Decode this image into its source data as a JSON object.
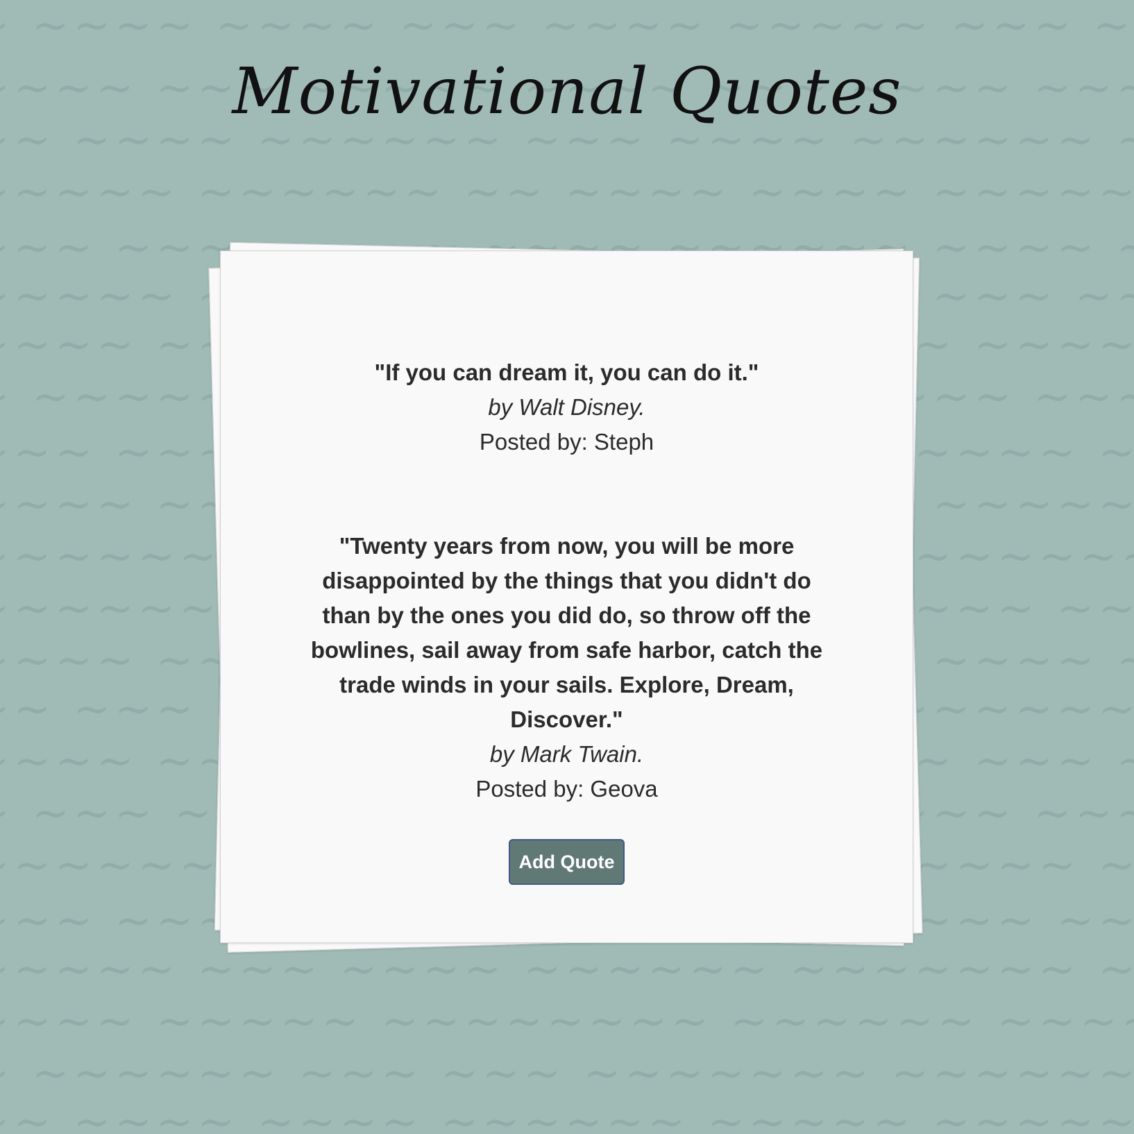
{
  "page": {
    "title": "Motivational Quotes"
  },
  "quotes": [
    {
      "text": "\"If you can dream it, you can do it.\"",
      "author": "by Walt Disney.",
      "poster": "Posted by: Steph"
    },
    {
      "text": "\"Twenty years from now, you will be more disappointed by the things that you didn't do than by the ones you did do, so throw off the bowlines, sail away from safe harbor, catch the trade winds in your sails. Explore, Dream, Discover.\"",
      "author": "by Mark Twain.",
      "poster": "Posted by: Geova"
    }
  ],
  "actions": {
    "add_quote_label": "Add Quote"
  },
  "colors": {
    "background": "#a0bab5",
    "paper": "#f9f9f9",
    "button": "#617974",
    "button_border": "#3e5a8a",
    "text": "#2b2b2b"
  }
}
